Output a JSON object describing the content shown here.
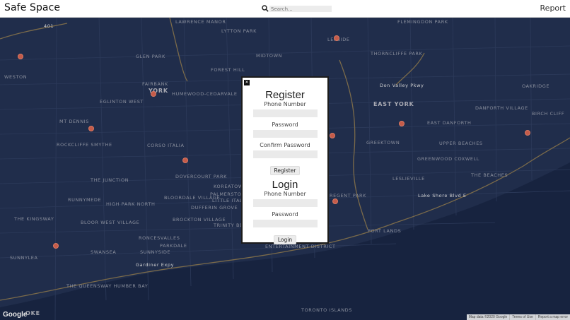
{
  "header": {
    "brand": "Safe Space",
    "search_placeholder": "Search...",
    "report_label": "Report"
  },
  "modal": {
    "close_glyph": "✕",
    "register": {
      "title": "Register",
      "phone_label": "Phone Number",
      "password_label": "Password",
      "confirm_label": "Confirm Password",
      "button_label": "Register"
    },
    "login": {
      "title": "Login",
      "phone_label": "Phone Number",
      "password_label": "Password",
      "button_label": "Login"
    }
  },
  "map": {
    "labels": [
      "LAWRENCE MANOR",
      "LYTTON PARK",
      "FLEMINGDON PARK",
      "LEASIDE",
      "THORNCLIFFE PARK",
      "GLEN PARK",
      "MIDTOWN",
      "YORK",
      "FOREST HILL",
      "WESTON",
      "FAIRBANK",
      "HUMEWOOD-CEDARVALE",
      "EGLINTON WEST",
      "EAST YORK",
      "OAKRIDGE",
      "MT DENNIS",
      "DANFORTH VILLAGE",
      "EAST DANFORTH",
      "BIRCH CLIFF",
      "ROCKCLIFFE SMYTHE",
      "CORSO ITALIA",
      "GREEKTOWN",
      "UPPER BEACHES",
      "GREENWOOD COXWELL",
      "THE JUNCTION",
      "DOVERCOURT PARK",
      "LESLIEVILLE",
      "THE BEACHES",
      "RUNNYMEDE",
      "HIGH PARK NORTH",
      "BLOORDALE VILLAGE",
      "PALMERSTON",
      "LITTLE ITALY",
      "KOREATOWN",
      "REGENT PARK",
      "THE KINGSWAY",
      "BLOOR WEST VILLAGE",
      "DUFFERIN GROVE",
      "BROCKTON VILLAGE",
      "TRINITY BELLWOODS",
      "PORT LANDS",
      "RONCESVALLES",
      "PARKDALE",
      "SUNNYSIDE",
      "ENTERTAINMENT DISTRICT",
      "SUNNYLEA",
      "SWANSEA",
      "THE QUEENSWAY HUMBER BAY",
      "TORONTO ISLANDS",
      "OKE"
    ],
    "road_labels": [
      "Don Valley Pkwy",
      "Gardiner Expy",
      "Lake Shore Blvd E",
      "401"
    ],
    "google_logo": "Google",
    "attribution": [
      "Map data ©2020 Google",
      "Terms of Use",
      "Report a map error"
    ]
  }
}
